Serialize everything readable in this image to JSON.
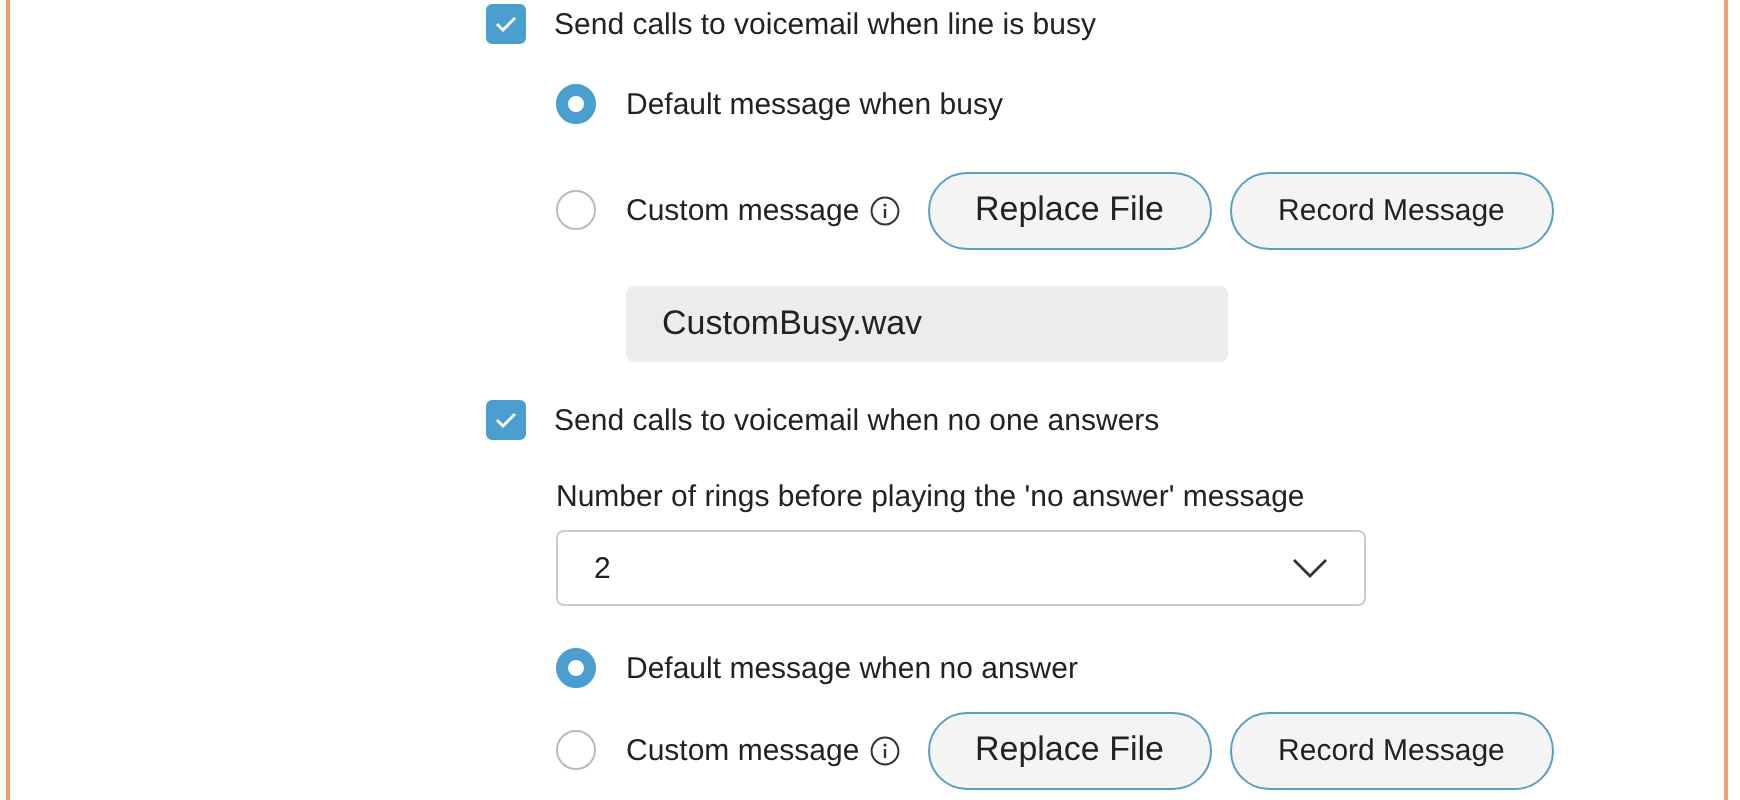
{
  "sections": [
    {
      "checkbox": {
        "label": "Send calls to voicemail when line is busy",
        "checked": true
      },
      "items": [
        {
          "kind": "radio",
          "label": "Default message when busy",
          "selected": true
        },
        {
          "kind": "radio",
          "label": "Custom message",
          "selected": false,
          "info": true,
          "buttons": [
            "Replace File",
            "Record Message"
          ]
        },
        {
          "kind": "file",
          "value": "CustomBusy.wav"
        }
      ]
    },
    {
      "checkbox": {
        "label": "Send calls to voicemail when no one answers",
        "checked": true
      },
      "items": [
        {
          "kind": "label",
          "text": "Number of rings before playing the 'no answer' message"
        },
        {
          "kind": "select",
          "value": "2"
        },
        {
          "kind": "radio",
          "label": "Default message when no answer",
          "selected": true
        },
        {
          "kind": "radio",
          "label": "Custom message",
          "selected": false,
          "info": true,
          "buttons": [
            "Replace File",
            "Record Message"
          ]
        }
      ]
    }
  ]
}
